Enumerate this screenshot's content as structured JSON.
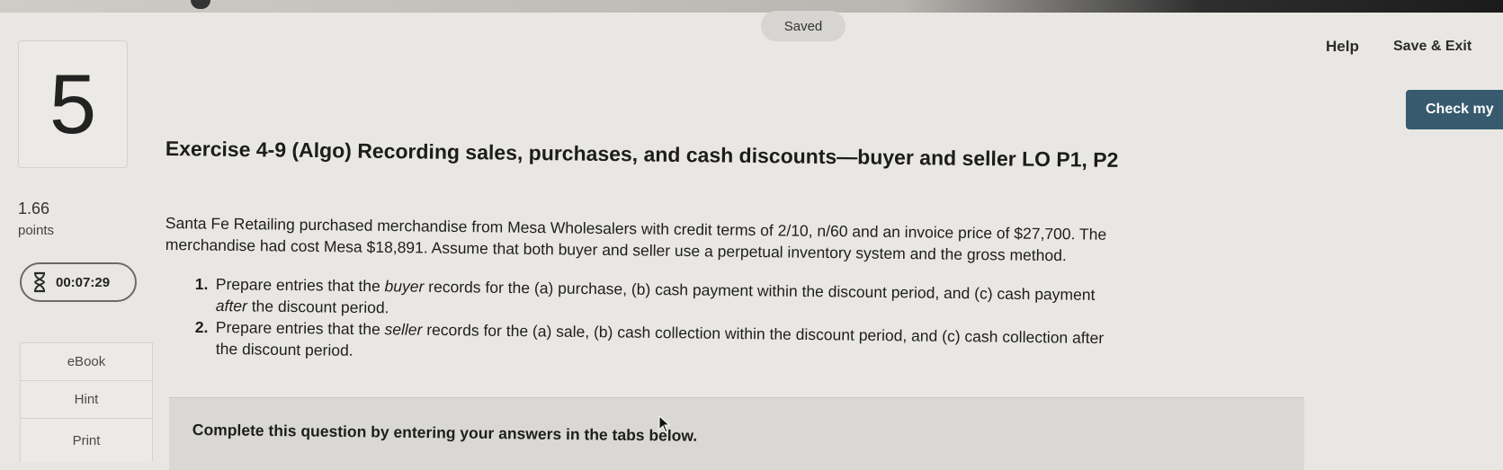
{
  "header": {
    "status": "Saved",
    "help_label": "Help",
    "save_exit_label": "Save & Exit",
    "check_label": "Check my"
  },
  "question": {
    "number": "5",
    "points_value": "1.66",
    "points_label": "points",
    "timer": "00:07:29",
    "title": "Exercise 4-9 (Algo) Recording sales, purchases, and cash discounts—buyer and seller LO P1, P2",
    "intro_lines": [
      "Santa Fe Retailing purchased merchandise from Mesa Wholesalers with credit terms of 2/10, n/60 and an invoice price of $27,700. The",
      "merchandise had cost Mesa $18,891. Assume that both buyer and seller use a perpetual inventory system and the gross method."
    ],
    "tasks": [
      {
        "num": "1.",
        "line1_pre": "Prepare entries that the ",
        "line1_em": "buyer",
        "line1_post": " records for the (a) purchase, (b) cash payment within the discount period, and (c) cash payment",
        "line2_em": "after",
        "line2_post": " the discount period."
      },
      {
        "num": "2.",
        "line1_pre": "Prepare entries that the ",
        "line1_em": "seller",
        "line1_post": " records for the (a) sale, (b) cash collection within the discount period, and (c) cash collection after",
        "line2_em": "",
        "line2_post": "the discount period."
      }
    ],
    "answer_instruction": "Complete this question by entering your answers in the tabs below."
  },
  "sidebar": {
    "ebook_label": "eBook",
    "hint_label": "Hint",
    "print_label": "Print"
  },
  "icons": {
    "timer": "hourglass-icon",
    "cursor": "mouse-cursor-icon"
  },
  "colors": {
    "check_button": "#375a6e",
    "background": "#e9e7e3",
    "answer_panel": "#d9d8d4"
  }
}
